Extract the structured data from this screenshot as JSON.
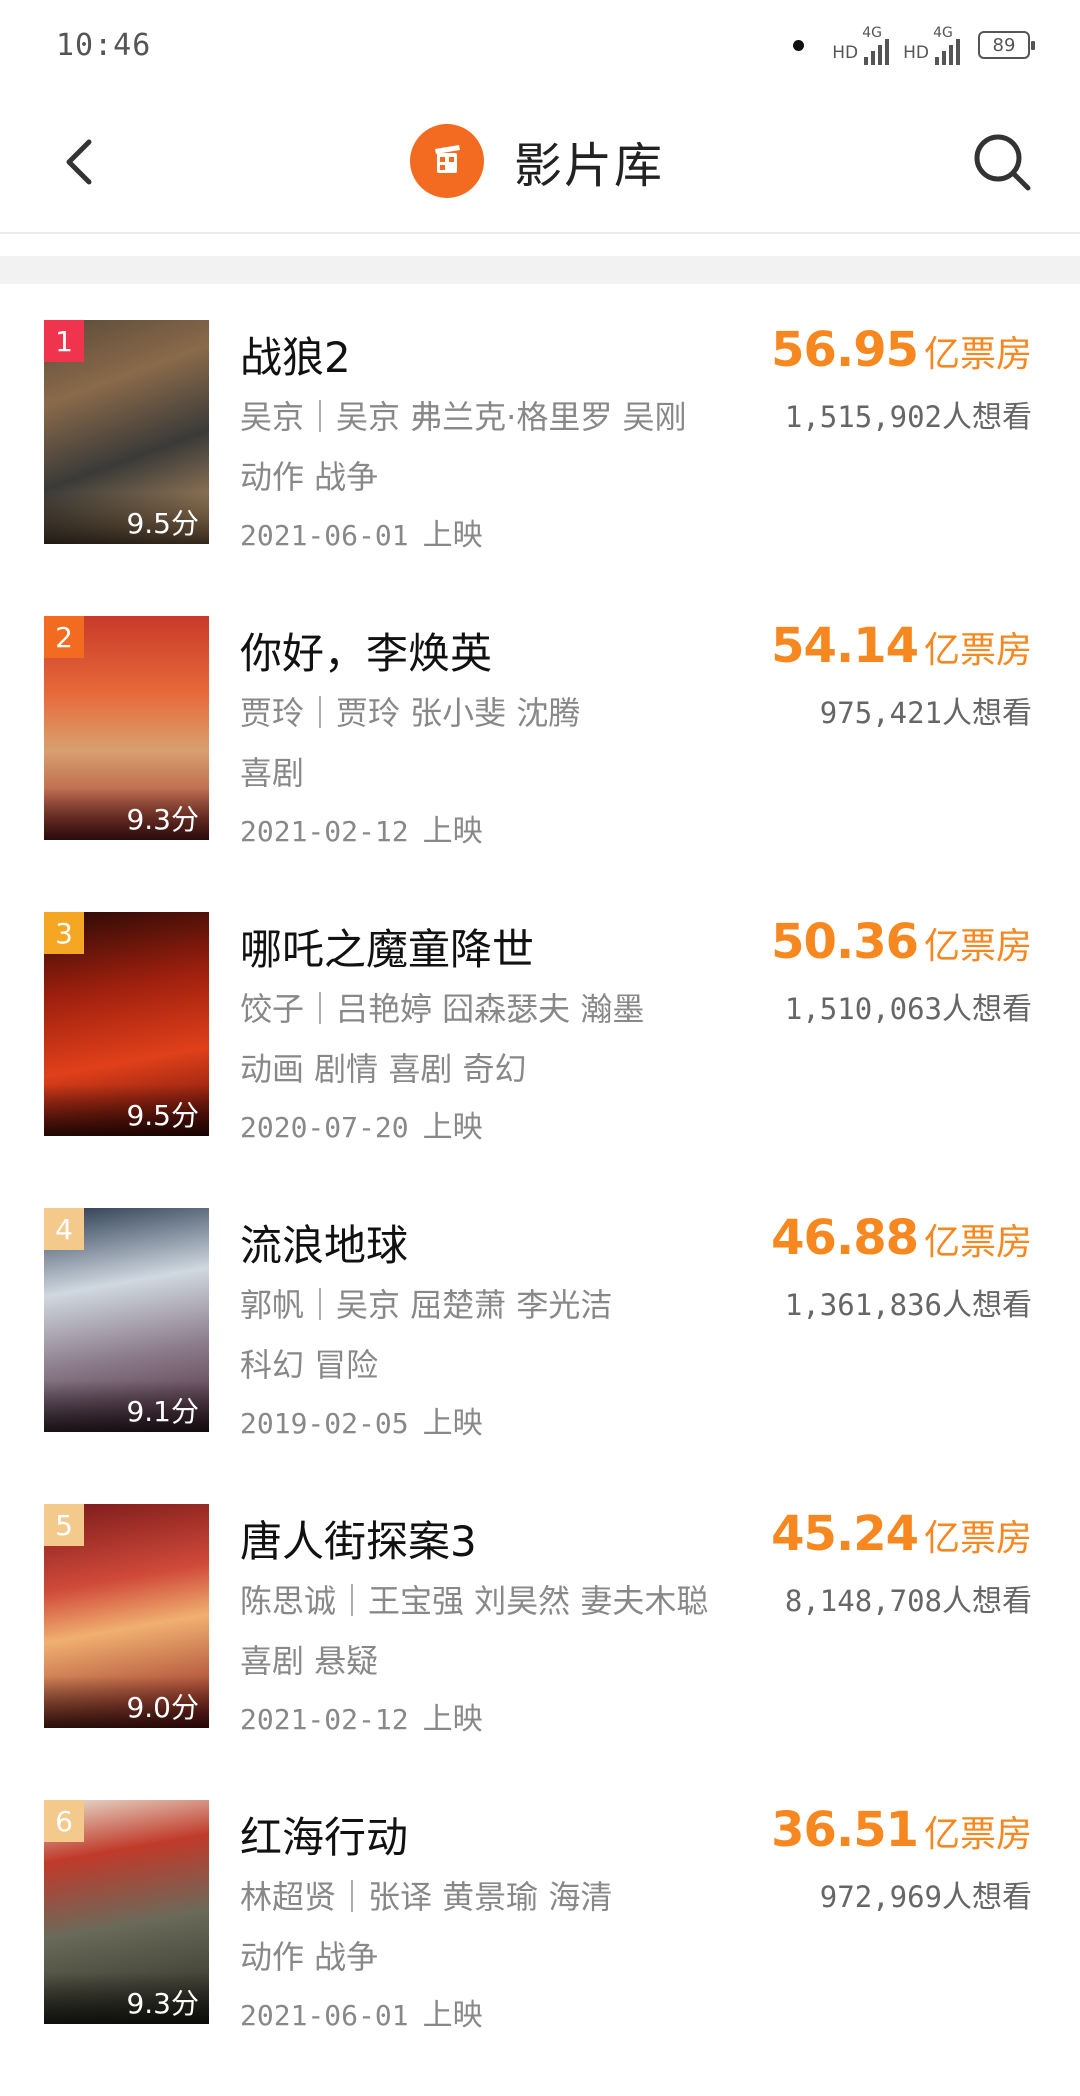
{
  "status_bar": {
    "time": "10:46",
    "hd1": "HD",
    "net1": "4G",
    "hd2": "HD",
    "net2": "4G",
    "battery": "89"
  },
  "header": {
    "title": "影片库"
  },
  "colors": {
    "accent": "#f7871f",
    "logo": "#f26b21"
  },
  "release_suffix": "上映",
  "movies": [
    {
      "rank": "1",
      "rank_color": "#f0344e",
      "title": "战狼2",
      "cast": "吴京｜吴京  弗兰克·格里罗  吴刚",
      "genres": "动作  战争",
      "date": "2021-06-01",
      "score": "9.5分",
      "box_office": "56.95",
      "box_unit": "亿票房",
      "want_count": "1,515,902",
      "want_suffix": "人想看"
    },
    {
      "rank": "2",
      "rank_color": "#f26b21",
      "title": "你好，李焕英",
      "cast": "贾玲｜贾玲  张小斐  沈腾",
      "genres": "喜剧",
      "date": "2021-02-12",
      "score": "9.3分",
      "box_office": "54.14",
      "box_unit": "亿票房",
      "want_count": "975,421",
      "want_suffix": "人想看"
    },
    {
      "rank": "3",
      "rank_color": "#f5a623",
      "title": "哪吒之魔童降世",
      "cast": "饺子｜吕艳婷  囧森瑟夫  瀚墨",
      "genres": "动画  剧情  喜剧  奇幻",
      "date": "2020-07-20",
      "score": "9.5分",
      "box_office": "50.36",
      "box_unit": "亿票房",
      "want_count": "1,510,063",
      "want_suffix": "人想看"
    },
    {
      "rank": "4",
      "rank_color": "#f3c98c",
      "title": "流浪地球",
      "cast": "郭帆｜吴京  屈楚萧  李光洁",
      "genres": "科幻  冒险",
      "date": "2019-02-05",
      "score": "9.1分",
      "box_office": "46.88",
      "box_unit": "亿票房",
      "want_count": "1,361,836",
      "want_suffix": "人想看"
    },
    {
      "rank": "5",
      "rank_color": "#f3c98c",
      "title": "唐人街探案3",
      "cast": "陈思诚｜王宝强  刘昊然  妻夫木聪",
      "genres": "喜剧  悬疑",
      "date": "2021-02-12",
      "score": "9.0分",
      "box_office": "45.24",
      "box_unit": "亿票房",
      "want_count": "8,148,708",
      "want_suffix": "人想看"
    },
    {
      "rank": "6",
      "rank_color": "#f3c98c",
      "title": "红海行动",
      "cast": "林超贤｜张译  黄景瑜  海清",
      "genres": "动作  战争",
      "date": "2021-06-01",
      "score": "9.3分",
      "box_office": "36.51",
      "box_unit": "亿票房",
      "want_count": "972,969",
      "want_suffix": "人想看"
    }
  ]
}
